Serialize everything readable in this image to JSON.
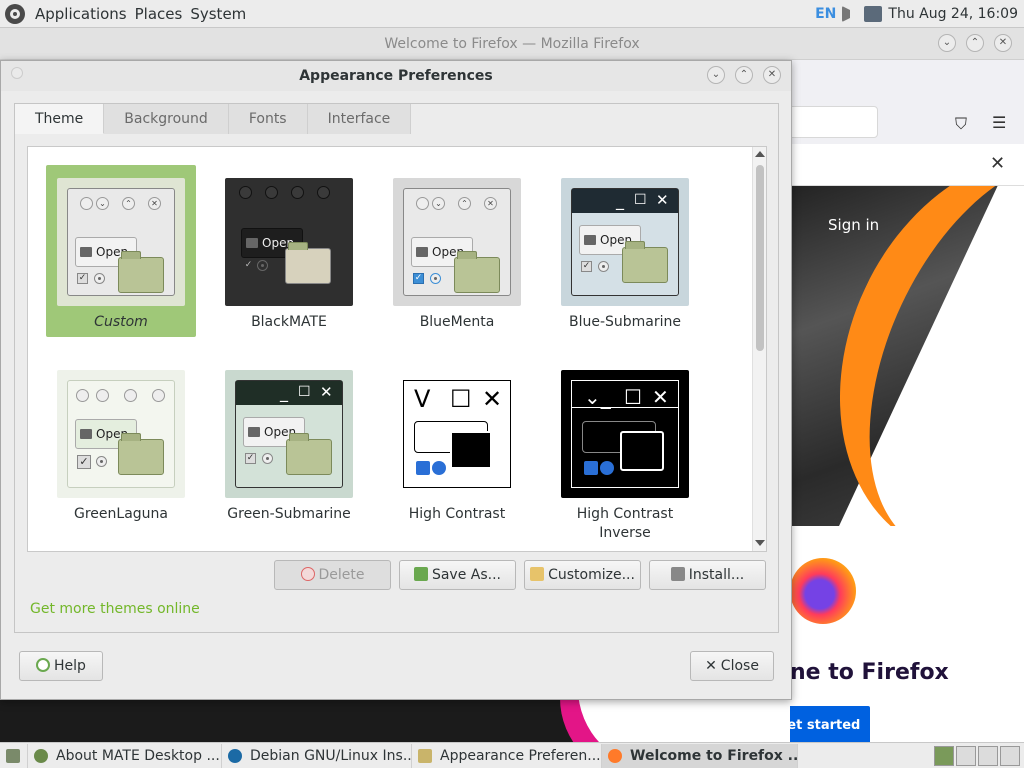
{
  "top_panel": {
    "menus": [
      "Applications",
      "Places",
      "System"
    ],
    "keyboard_layout": "EN",
    "clock": "Thu Aug 24, 16:09"
  },
  "firefox": {
    "window_title": "Welcome to Firefox — Mozilla Firefox",
    "sign_in": "Sign in",
    "welcome_text": "ne to Firefox",
    "get_started": "Get started"
  },
  "dialog": {
    "title": "Appearance Preferences",
    "tabs": [
      {
        "label": "Theme",
        "active": true
      },
      {
        "label": "Background",
        "active": false
      },
      {
        "label": "Fonts",
        "active": false
      },
      {
        "label": "Interface",
        "active": false
      }
    ],
    "themes": [
      {
        "name": "Custom",
        "selected": true
      },
      {
        "name": "BlackMATE",
        "selected": false
      },
      {
        "name": "BlueMenta",
        "selected": false
      },
      {
        "name": "Blue-Submarine",
        "selected": false
      },
      {
        "name": "GreenLaguna",
        "selected": false
      },
      {
        "name": "Green-Submarine",
        "selected": false
      },
      {
        "name": "High Contrast",
        "selected": false
      },
      {
        "name": "High Contrast Inverse",
        "selected": false
      }
    ],
    "thumb_open_label": "Open",
    "buttons": {
      "delete": "Delete",
      "save_as": "Save As...",
      "customize": "Customize...",
      "install": "Install..."
    },
    "more_themes_link": "Get more themes online",
    "help": "Help",
    "close": "Close",
    "colors": {
      "selection": "#9fc878",
      "link": "#73b72a"
    }
  },
  "taskbar": {
    "items": [
      {
        "label": "About MATE Desktop ...",
        "active": false
      },
      {
        "label": "Debian GNU/Linux Ins...",
        "active": false
      },
      {
        "label": "Appearance Preferen...",
        "active": false
      },
      {
        "label": "Welcome to Firefox ...",
        "active": true
      }
    ]
  }
}
